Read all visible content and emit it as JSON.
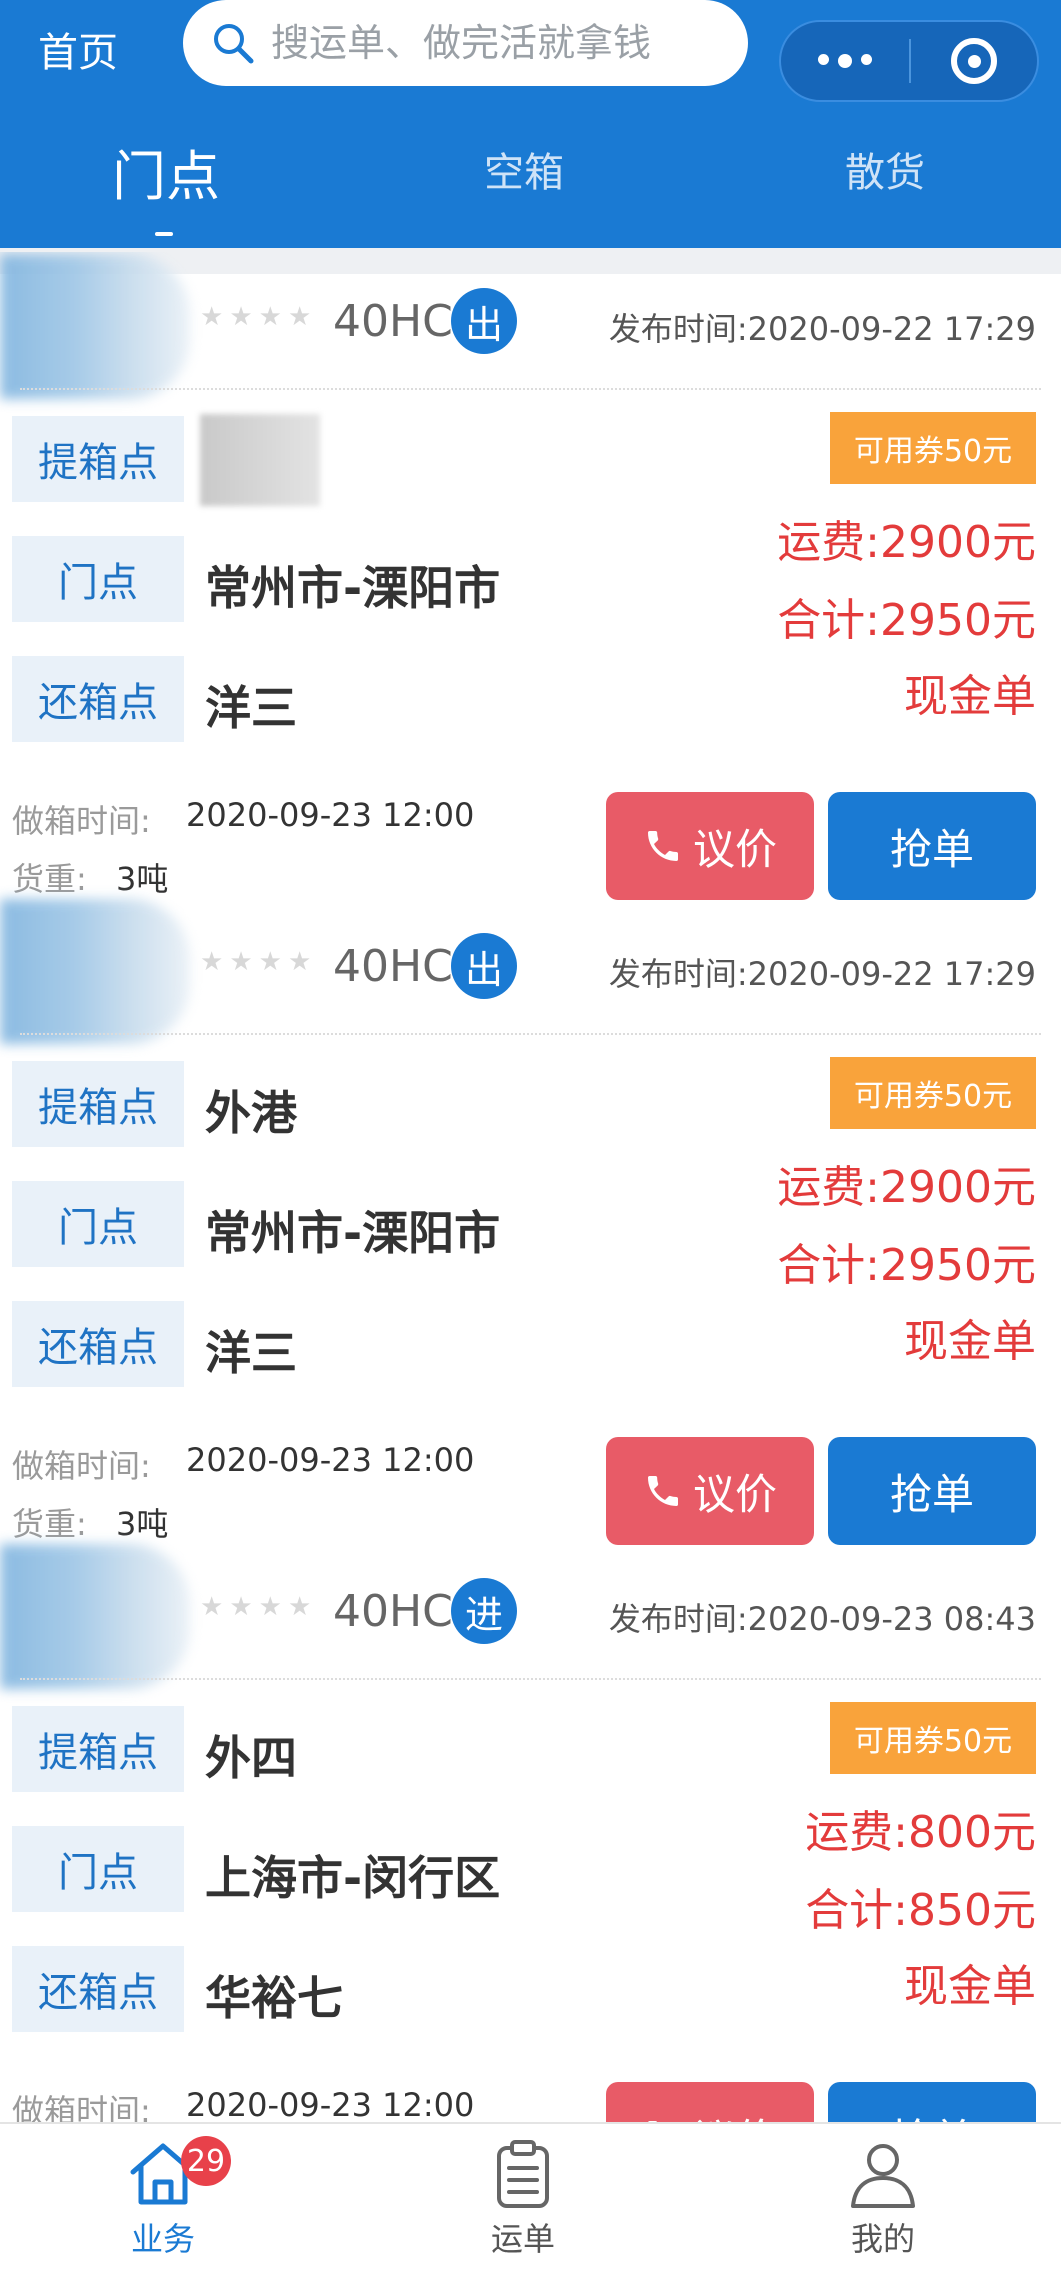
{
  "header": {
    "home_label": "首页",
    "search_placeholder": "搜运单、做完活就拿钱"
  },
  "tabs": [
    {
      "label": "门点",
      "active": true
    },
    {
      "label": "空箱",
      "active": false
    },
    {
      "label": "散货",
      "active": false
    }
  ],
  "labels": {
    "pickup": "提箱点",
    "door": "门点",
    "return": "还箱点",
    "build_time": "做箱时间:",
    "weight": "货重:",
    "negotiate": "议价",
    "grab": "抢单"
  },
  "orders": [
    {
      "container_type": "40HC",
      "direction": "出",
      "publish_time": "发布时间:2020-09-22 17:29",
      "pickup": "",
      "door": "常州市-溧阳市",
      "return": "洋三",
      "coupon": "可用券50元",
      "freight": "运费:2900元",
      "total": "合计:2950元",
      "payment": "现金单",
      "build_time": "2020-09-23 12:00",
      "weight": "3吨"
    },
    {
      "container_type": "40HC",
      "direction": "出",
      "publish_time": "发布时间:2020-09-22 17:29",
      "pickup": "外港",
      "door": "常州市-溧阳市",
      "return": "洋三",
      "coupon": "可用券50元",
      "freight": "运费:2900元",
      "total": "合计:2950元",
      "payment": "现金单",
      "build_time": "2020-09-23 12:00",
      "weight": "3吨"
    },
    {
      "container_type": "40HC",
      "direction": "进",
      "publish_time": "发布时间:2020-09-23 08:43",
      "pickup": "外四",
      "door": "上海市-闵行区",
      "return": "华裕七",
      "coupon": "可用券50元",
      "freight": "运费:800元",
      "total": "合计:850元",
      "payment": "现金单",
      "build_time": "2020-09-23 12:00",
      "weight": ""
    }
  ],
  "tabbar": [
    {
      "label": "业务",
      "icon": "home-icon",
      "badge": "29",
      "active": true
    },
    {
      "label": "运单",
      "icon": "clipboard-icon",
      "active": false
    },
    {
      "label": "我的",
      "icon": "user-icon",
      "active": false
    }
  ],
  "colors": {
    "primary": "#1a7ad3",
    "price": "#e33b3b",
    "coupon": "#f9a33b",
    "negotiate": "#e85b67"
  }
}
